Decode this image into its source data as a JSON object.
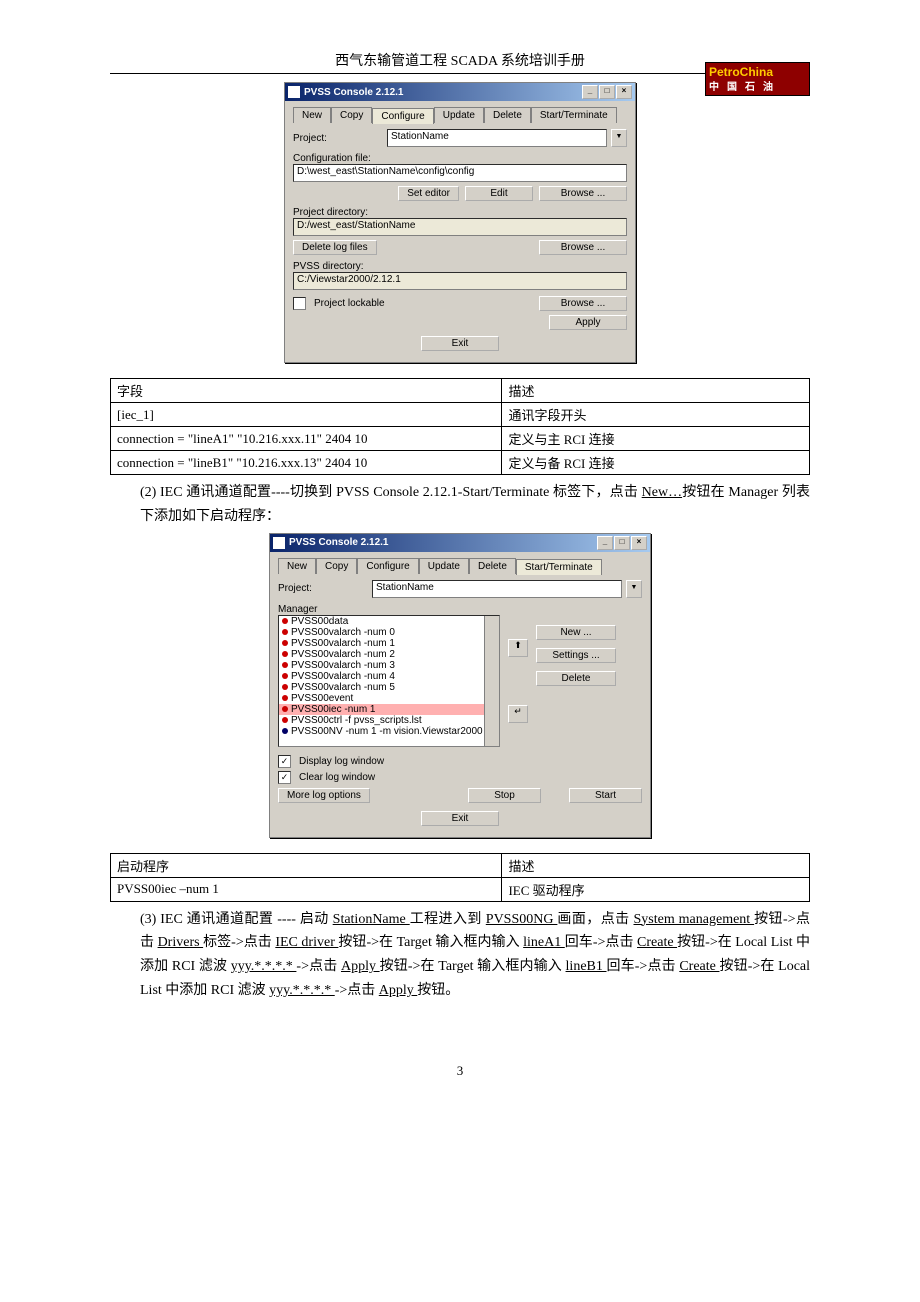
{
  "header": {
    "title": "西气东输管道工程 SCADA 系统培训手册",
    "logo_top": "PetroChina",
    "logo_sub": "中国石油"
  },
  "dialog1": {
    "title": "PVSS Console 2.12.1",
    "tabs": {
      "new": "New",
      "copy": "Copy",
      "configure": "Configure",
      "update": "Update",
      "delete": "Delete",
      "start": "Start/Terminate"
    },
    "project_lbl": "Project:",
    "project_val": "StationName",
    "config_lbl": "Configuration file:",
    "config_val": "D:\\west_east\\StationName\\config\\config",
    "set_editor": "Set editor",
    "edit": "Edit",
    "browse": "Browse ...",
    "projdir_lbl": "Project directory:",
    "projdir_val": "D:/west_east/StationName",
    "del_log": "Delete log files",
    "pvssdir_lbl": "PVSS directory:",
    "pvssdir_val": "C:/Viewstar2000/2.12.1",
    "lockable": "Project lockable",
    "apply": "Apply",
    "exit": "Exit"
  },
  "table1": {
    "h1": "字段",
    "h2": "描述",
    "r1c1": "[iec_1]",
    "r1c2": "通讯字段开头",
    "r2c1": "connection = \"lineA1\" \"10.216.xxx.11\" 2404 10",
    "r2c2": "定义与主 RCI 连接",
    "r3c1": "connection = \"lineB1\" \"10.216.xxx.13\" 2404 10",
    "r3c2": "定义与备 RCI 连接"
  },
  "para2_pre": "(2) IEC 通讯通道配置----切换到 PVSS Console 2.12.1-Start/Terminate 标签下，点击 ",
  "para2_link1": "New…",
  "para2_post": "按钮在 Manager 列表下添加如下启动程序：",
  "dialog2": {
    "title": "PVSS Console 2.12.1",
    "tabs": {
      "new": "New",
      "copy": "Copy",
      "configure": "Configure",
      "update": "Update",
      "delete": "Delete",
      "start": "Start/Terminate"
    },
    "project_lbl": "Project:",
    "project_val": "StationName",
    "manager_lbl": "Manager",
    "items": [
      "PVSS00data",
      "PVSS00valarch -num 0",
      "PVSS00valarch -num 1",
      "PVSS00valarch -num 2",
      "PVSS00valarch -num 3",
      "PVSS00valarch -num 4",
      "PVSS00valarch -num 5",
      "PVSS00event",
      "PVSS00iec -num 1",
      "PVSS00ctrl -f pvss_scripts.lst",
      "PVSS00NV -num 1 -m vision.Viewstar2000"
    ],
    "new": "New ...",
    "settings": "Settings ...",
    "delete": "Delete",
    "disp_log": "Display log window",
    "clear_log": "Clear log window",
    "more_log": "More log options",
    "stop": "Stop",
    "start": "Start",
    "exit": "Exit"
  },
  "table2": {
    "h1": "启动程序",
    "h2": "描述",
    "r1c1": "PVSS00iec  –num 1",
    "r1c2": "IEC 驱动程序"
  },
  "para3": {
    "t1": "(3) IEC 通讯通道配置 ---- 启动 ",
    "u1": "StationName ",
    "t2": "工程进入到 ",
    "u2": "PVSS00NG ",
    "t3": "画面，点击 ",
    "u3": "System management ",
    "t4": "按钮->点击 ",
    "u4": "Drivers ",
    "t5": "标签->点击 ",
    "u5": "IEC  driver ",
    "t6": "按钮->在 Target 输入框内输入 ",
    "u6": "lineA1 ",
    "t7": "回车->点击 ",
    "u7": "Create ",
    "t8": "按钮->在 Local List 中添加 RCI 滤波 ",
    "u8": "yyy.*.*.*.* ",
    "t9": "->点击 ",
    "u9": "Apply ",
    "t10": "按钮->在 Target 输入框内输入 ",
    "u10": "lineB1 ",
    "t11": "回车->点击 ",
    "u11": "Create ",
    "t12": "按钮->在 Local List 中添加 RCI 滤波 ",
    "u12": "yyy.*.*.*.* ",
    "t13": "->点击 ",
    "u13": "Apply ",
    "t14": "按钮。"
  },
  "page_num": "3"
}
